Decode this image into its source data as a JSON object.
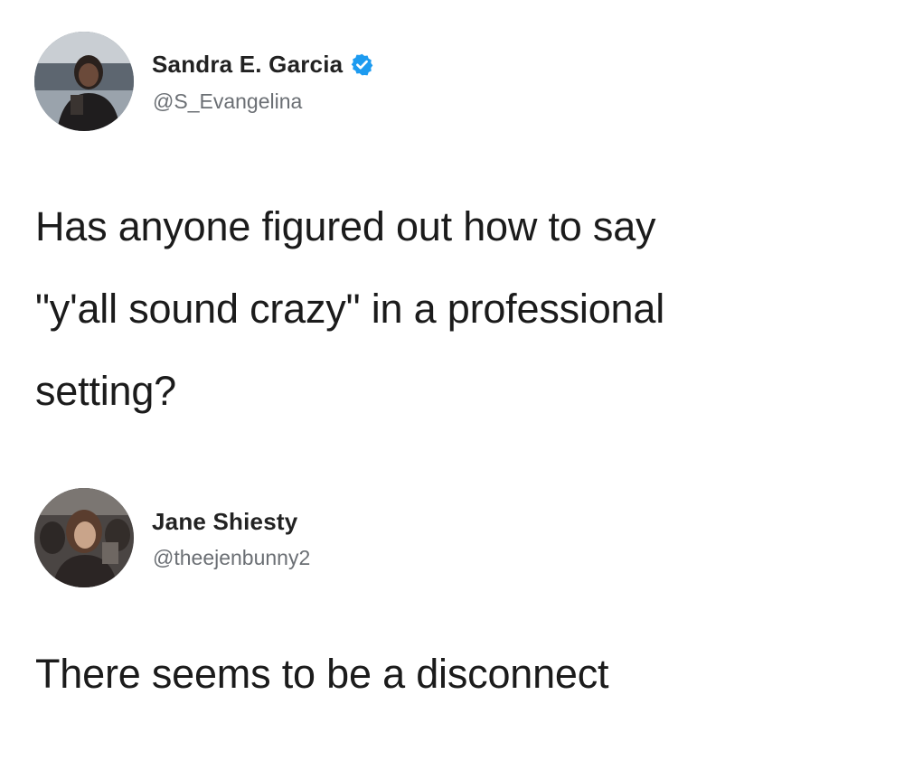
{
  "tweets": [
    {
      "display_name": "Sandra E. Garcia",
      "handle": "@S_Evangelina",
      "verified": true,
      "text_lines": [
        "Has anyone figured out how to say",
        "\"y'all sound crazy\" in a professional",
        "setting?"
      ]
    },
    {
      "display_name": "Jane Shiesty",
      "handle": "@theejenbunny2",
      "verified": false,
      "text_lines": [
        "There seems to be a disconnect"
      ]
    }
  ],
  "colors": {
    "verified_blue": "#1d9bf0",
    "text_primary": "#1b1b1b",
    "text_secondary": "#6b6f74"
  }
}
